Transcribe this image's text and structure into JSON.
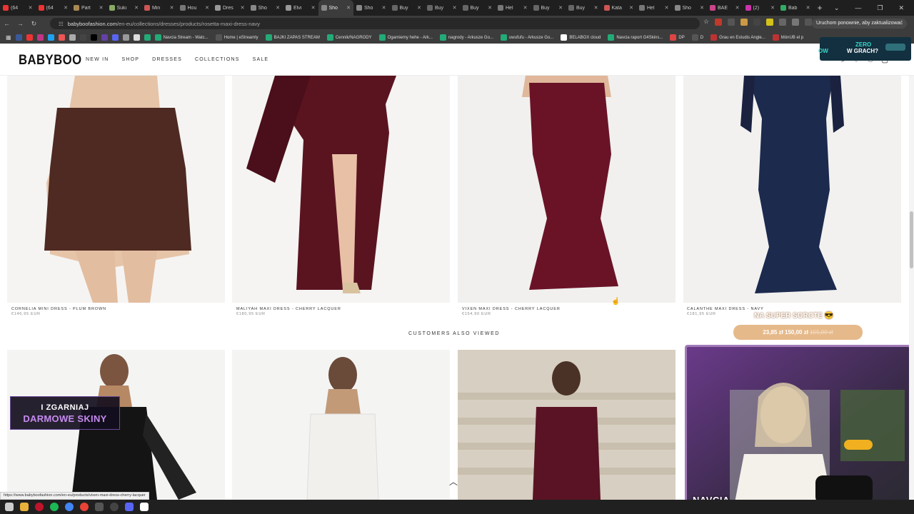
{
  "browser": {
    "tabs": [
      {
        "label": "(64"
      },
      {
        "label": "(64"
      },
      {
        "label": "Part"
      },
      {
        "label": "Sukı"
      },
      {
        "label": "Min"
      },
      {
        "label": "Hou"
      },
      {
        "label": "Dres"
      },
      {
        "label": "Sho"
      },
      {
        "label": "Elvi"
      },
      {
        "label": "Sho"
      },
      {
        "label": "Sho"
      },
      {
        "label": "Buy"
      },
      {
        "label": "Buy"
      },
      {
        "label": "Buy"
      },
      {
        "label": "Hel"
      },
      {
        "label": "Buy"
      },
      {
        "label": "Buy"
      },
      {
        "label": "Kata"
      },
      {
        "label": "Hel"
      },
      {
        "label": "Sho"
      },
      {
        "label": "BAE"
      },
      {
        "label": "(2)"
      },
      {
        "label": "Bab"
      }
    ],
    "active_tab_index": 9,
    "url_domain": "babyboofashion.com",
    "url_path": "/en-eu/collections/dresses/products/rosetta-maxi-dress-navy",
    "update_message": "Uruchom ponownie, aby zaktualizować",
    "bookmarks": [
      {
        "label": "Navcia Stream - Watc..."
      },
      {
        "label": "Home | eStreamly"
      },
      {
        "label": "BAJKI ZAPAS STREAM"
      },
      {
        "label": "Cennik/NAGRODY"
      },
      {
        "label": "Ogarniemy hehe - Ark..."
      },
      {
        "label": "nagrody - Arkusze Go..."
      },
      {
        "label": "uwufufu - Arkusze Go..."
      },
      {
        "label": "BELABOX cloud"
      },
      {
        "label": "Navcia raport G4Skins..."
      },
      {
        "label": "DP"
      },
      {
        "label": "D"
      },
      {
        "label": "Grau en Estudis Angle..."
      },
      {
        "label": "MónUB el p"
      }
    ]
  },
  "site": {
    "logo": "BABYBOO",
    "nav": [
      {
        "label": "NEW IN"
      },
      {
        "label": "SHOP"
      },
      {
        "label": "DRESSES"
      },
      {
        "label": "COLLECTIONS"
      },
      {
        "label": "SALE"
      }
    ]
  },
  "products_top": [
    {
      "name": "CORNELIA MINI DRESS - PLUM BROWN",
      "price": "€146,95 EUR",
      "color": "#4e2a22"
    },
    {
      "name": "MALIYAH MAXI DRESS - CHERRY LACQUER",
      "price": "€180,95 EUR",
      "color": "#5a1420"
    },
    {
      "name": "VIXEN MAXI DRESS - CHERRY LACQUER",
      "price": "€154,90 EUR",
      "color": "#6a1327"
    },
    {
      "name": "CALANTHE MAXI DRESS - NAVY",
      "price": "€181,95 EUR",
      "color": "#1c2a4e"
    }
  ],
  "section_title": "CUSTOMERS ALSO VIEWED",
  "products_bottom": [
    {
      "color": "#141414"
    },
    {
      "color": "#f2f0ec"
    },
    {
      "color": "#5a1324"
    }
  ],
  "overlays": {
    "promo_line1": "ZERO",
    "promo_line2": "W GRACH?",
    "promo_left": "OW",
    "skins_line1": "I ZGARNIAJ",
    "skins_line2": "DARMOWE SKINY",
    "sorcery_text": "NA SUPER SORCTE 😎",
    "price_pill": "23,85 zł   150,00 zł",
    "price_old": "155,00 zł",
    "webcam_name": "NAVCIA"
  },
  "status_url": "https://www.babyboofashion.com/en-eu/products/vixen-maxi-dress-cherry-lacquer",
  "colors": {
    "accent": "#e6b98a",
    "skins": "#c58af0",
    "webcam_border": "#a27ab8"
  }
}
